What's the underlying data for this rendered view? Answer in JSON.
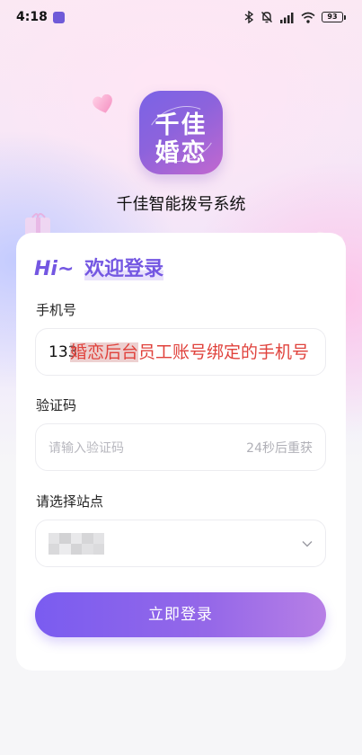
{
  "status_bar": {
    "time": "4:18",
    "battery": "93",
    "icons": [
      "app-badge-icon",
      "bluetooth-icon",
      "mute-bell-icon",
      "signal-icon",
      "wifi-icon",
      "battery-icon"
    ]
  },
  "app": {
    "logo_line1": "千佳",
    "logo_line2": "婚恋",
    "title": "千佳智能拨号系统"
  },
  "login_card": {
    "greeting_prefix": "Hi~",
    "greeting": "欢迎登录",
    "phone": {
      "label": "手机号",
      "value": "133",
      "annotation_highlight": "婚恋后台",
      "annotation_rest": "员工账号绑定的手机号"
    },
    "code": {
      "label": "验证码",
      "placeholder": "请输入验证码",
      "resend_label": "24秒后重获"
    },
    "site": {
      "label": "请选择站点",
      "selected_value_obscured": true
    },
    "submit_label": "立即登录"
  },
  "colors": {
    "accent": "#7457e2",
    "button_start": "#7a5cf0",
    "button_end": "#b77fe6",
    "annotation_red": "#e0423c"
  }
}
